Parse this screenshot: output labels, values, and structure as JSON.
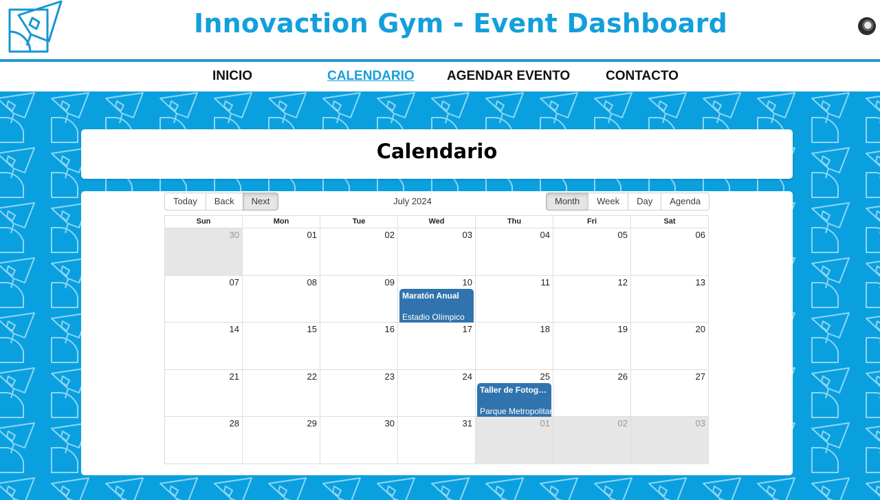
{
  "header": {
    "title": "Innovaction Gym - Event Dashboard",
    "logo_icon": "paper-plane-logo-icon",
    "avatar_icon": "user-avatar-icon"
  },
  "nav": {
    "items": [
      {
        "label": "INICIO",
        "active": false
      },
      {
        "label": "CALENDARIO",
        "active": true
      },
      {
        "label": "AGENDAR EVENTO",
        "active": false
      },
      {
        "label": "CONTACTO",
        "active": false
      }
    ]
  },
  "page": {
    "title": "Calendario"
  },
  "calendar": {
    "nav_buttons": [
      "Today",
      "Back",
      "Next"
    ],
    "label": "July 2024",
    "view_buttons": [
      "Month",
      "Week",
      "Day",
      "Agenda"
    ],
    "active_view": "Month",
    "weekdays": [
      "Sun",
      "Mon",
      "Tue",
      "Wed",
      "Thu",
      "Fri",
      "Sat"
    ],
    "weeks": [
      [
        {
          "d": "30",
          "off": true
        },
        {
          "d": "01"
        },
        {
          "d": "02"
        },
        {
          "d": "03"
        },
        {
          "d": "04"
        },
        {
          "d": "05"
        },
        {
          "d": "06"
        }
      ],
      [
        {
          "d": "07"
        },
        {
          "d": "08"
        },
        {
          "d": "09"
        },
        {
          "d": "10"
        },
        {
          "d": "11"
        },
        {
          "d": "12"
        },
        {
          "d": "13"
        }
      ],
      [
        {
          "d": "14"
        },
        {
          "d": "15"
        },
        {
          "d": "16"
        },
        {
          "d": "17"
        },
        {
          "d": "18"
        },
        {
          "d": "19"
        },
        {
          "d": "20"
        }
      ],
      [
        {
          "d": "21"
        },
        {
          "d": "22"
        },
        {
          "d": "23"
        },
        {
          "d": "24"
        },
        {
          "d": "25"
        },
        {
          "d": "26"
        },
        {
          "d": "27"
        }
      ],
      [
        {
          "d": "28"
        },
        {
          "d": "29"
        },
        {
          "d": "30"
        },
        {
          "d": "31"
        },
        {
          "d": "01",
          "off": true
        },
        {
          "d": "02",
          "off": true
        },
        {
          "d": "03",
          "off": true
        }
      ]
    ],
    "events": [
      {
        "week": 1,
        "day": 3,
        "title": "Maratón Anual",
        "location": "Estadio Olímpico"
      },
      {
        "week": 3,
        "day": 4,
        "title": "Taller de Fotografía",
        "location": "Parque Metropolitano"
      }
    ],
    "event_color": "#3174ad"
  },
  "colors": {
    "brand": "#139fdc",
    "background": "#0aa0df"
  }
}
